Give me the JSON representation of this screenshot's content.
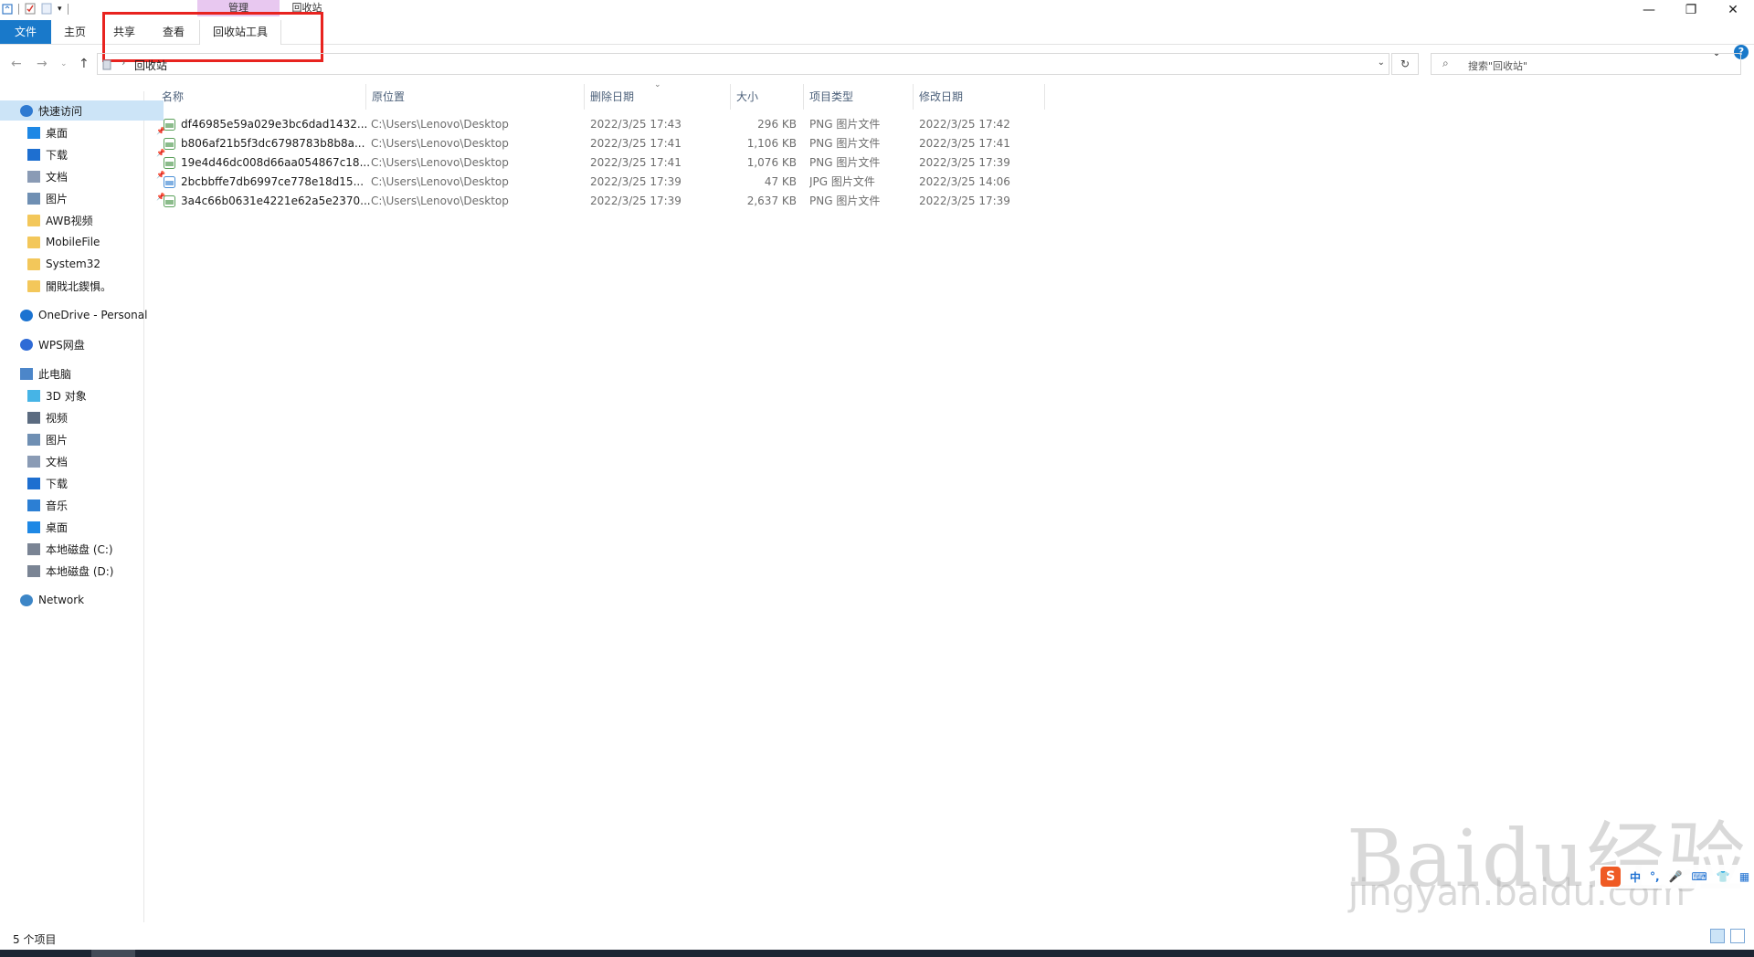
{
  "titlebar": {
    "context_group": "管理",
    "window_title": "回收站",
    "minimize": "—",
    "maximize": "❐",
    "close": "✕"
  },
  "ribbon": {
    "tabs": [
      "文件",
      "主页",
      "共享",
      "查看",
      "回收站工具"
    ],
    "expand": "⌄",
    "help": "?"
  },
  "nav": {
    "back": "←",
    "forward": "→",
    "recent": "⌄",
    "up": "↑"
  },
  "address": {
    "path": "回收站",
    "separator": "›",
    "dropdown": "⌄"
  },
  "refresh": "↻",
  "search": {
    "icon": "⌕",
    "placeholder": "搜索\"回收站\""
  },
  "sidebar": {
    "items": [
      {
        "label": "快速访问",
        "icon": "star-icon",
        "pinned": false
      },
      {
        "label": "桌面",
        "icon": "desktop-icon",
        "pinned": true
      },
      {
        "label": "下载",
        "icon": "download-icon",
        "pinned": true
      },
      {
        "label": "文档",
        "icon": "document-icon",
        "pinned": true
      },
      {
        "label": "图片",
        "icon": "picture-icon",
        "pinned": true
      },
      {
        "label": "AWB视频",
        "icon": "folder-icon",
        "pinned": false
      },
      {
        "label": "MobileFile",
        "icon": "folder-icon",
        "pinned": false
      },
      {
        "label": "System32",
        "icon": "folder-icon",
        "pinned": false
      },
      {
        "label": "閬戝北鍥惧。",
        "icon": "folder-icon",
        "pinned": false
      },
      {
        "label": "OneDrive - Personal",
        "icon": "onedrive-icon",
        "pinned": false
      },
      {
        "label": "WPS网盘",
        "icon": "wps-cloud-icon",
        "pinned": false
      },
      {
        "label": "此电脑",
        "icon": "computer-icon",
        "pinned": false
      },
      {
        "label": "3D 对象",
        "icon": "3d-objects-icon",
        "pinned": false
      },
      {
        "label": "视频",
        "icon": "video-icon",
        "pinned": false
      },
      {
        "label": "图片",
        "icon": "picture-icon",
        "pinned": false
      },
      {
        "label": "文档",
        "icon": "document-icon",
        "pinned": false
      },
      {
        "label": "下载",
        "icon": "download-icon",
        "pinned": false
      },
      {
        "label": "音乐",
        "icon": "music-icon",
        "pinned": false
      },
      {
        "label": "桌面",
        "icon": "desktop-icon",
        "pinned": false
      },
      {
        "label": "本地磁盘 (C:)",
        "icon": "drive-icon",
        "pinned": false
      },
      {
        "label": "本地磁盘 (D:)",
        "icon": "drive-icon",
        "pinned": false
      },
      {
        "label": "Network",
        "icon": "network-icon",
        "pinned": false
      }
    ],
    "pin_glyph": "📌"
  },
  "columns": [
    "名称",
    "原位置",
    "删除日期",
    "大小",
    "项目类型",
    "修改日期"
  ],
  "sort_indicator": "⌄",
  "files": [
    {
      "name": "df46985e59a029e3bc6dad1432...",
      "location": "C:\\Users\\Lenovo\\Desktop",
      "deleted": "2022/3/25 17:43",
      "size": "296 KB",
      "type": "PNG 图片文件",
      "modified": "2022/3/25 17:42",
      "icon": "png-file-icon"
    },
    {
      "name": "b806af21b5f3dc6798783b8b8a...",
      "location": "C:\\Users\\Lenovo\\Desktop",
      "deleted": "2022/3/25 17:41",
      "size": "1,106 KB",
      "type": "PNG 图片文件",
      "modified": "2022/3/25 17:41",
      "icon": "png-file-icon"
    },
    {
      "name": "19e4d46dc008d66aa054867c18...",
      "location": "C:\\Users\\Lenovo\\Desktop",
      "deleted": "2022/3/25 17:41",
      "size": "1,076 KB",
      "type": "PNG 图片文件",
      "modified": "2022/3/25 17:39",
      "icon": "png-file-icon"
    },
    {
      "name": "2bcbbffe7db6997ce778e18d15...",
      "location": "C:\\Users\\Lenovo\\Desktop",
      "deleted": "2022/3/25 17:39",
      "size": "47 KB",
      "type": "JPG 图片文件",
      "modified": "2022/3/25 14:06",
      "icon": "jpg-file-icon"
    },
    {
      "name": "3a4c66b0631e4221e62a5e2370...",
      "location": "C:\\Users\\Lenovo\\Desktop",
      "deleted": "2022/3/25 17:39",
      "size": "2,637 KB",
      "type": "PNG 图片文件",
      "modified": "2022/3/25 17:39",
      "icon": "png-file-icon"
    }
  ],
  "status": {
    "count": "5 个项目"
  },
  "watermark": {
    "brand": "Baidu经验",
    "url": "jingyan.baidu.com"
  },
  "ime": {
    "logo": "S",
    "lang": "中",
    "punct": "°,"
  },
  "colors": {
    "file_tab": "#1979ca",
    "selection": "#cce4f7",
    "highlight_box": "#e8231f",
    "context_tab": "#e8c8f0"
  }
}
